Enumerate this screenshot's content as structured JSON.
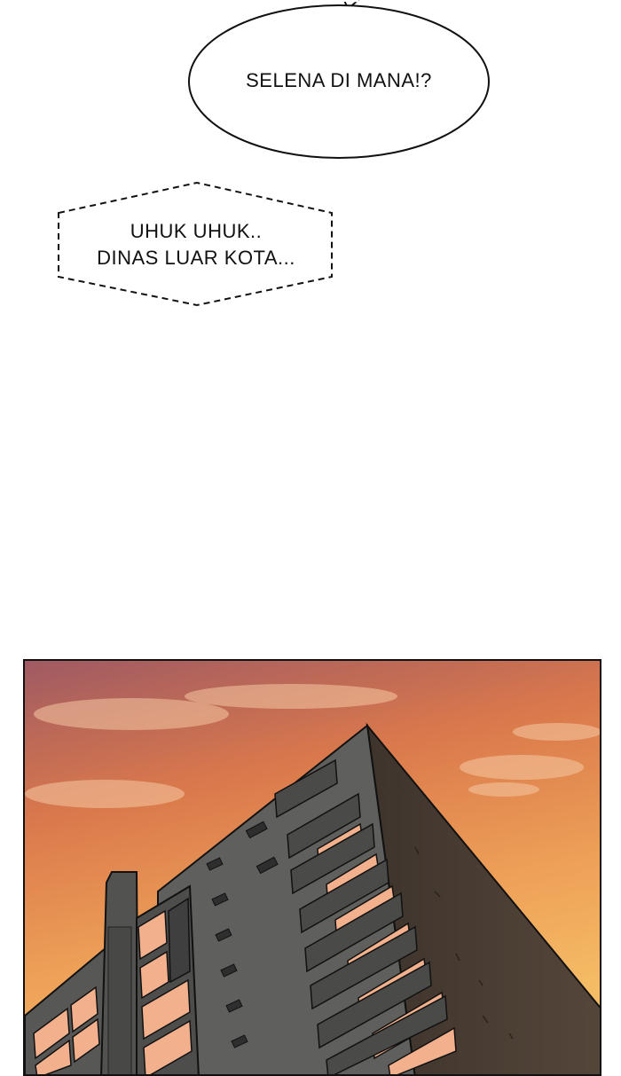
{
  "speech_bubble": {
    "text": "SELENA DI MANA!?"
  },
  "thought_bubble": {
    "lines": [
      "UHUK UHUK..",
      "DINAS LUAR KOTA..."
    ]
  },
  "scene": {
    "description_icon": "apartment-building-sunset-icon",
    "colors": {
      "sky_top": "#a05a63",
      "sky_mid": "#e08a4c",
      "sky_low": "#f4b662",
      "building_front": "#5f5f5d",
      "building_side": "#45392f",
      "window_lit": "#f3b08c",
      "window_dark": "#3a3a3a",
      "outline": "#111111"
    }
  }
}
